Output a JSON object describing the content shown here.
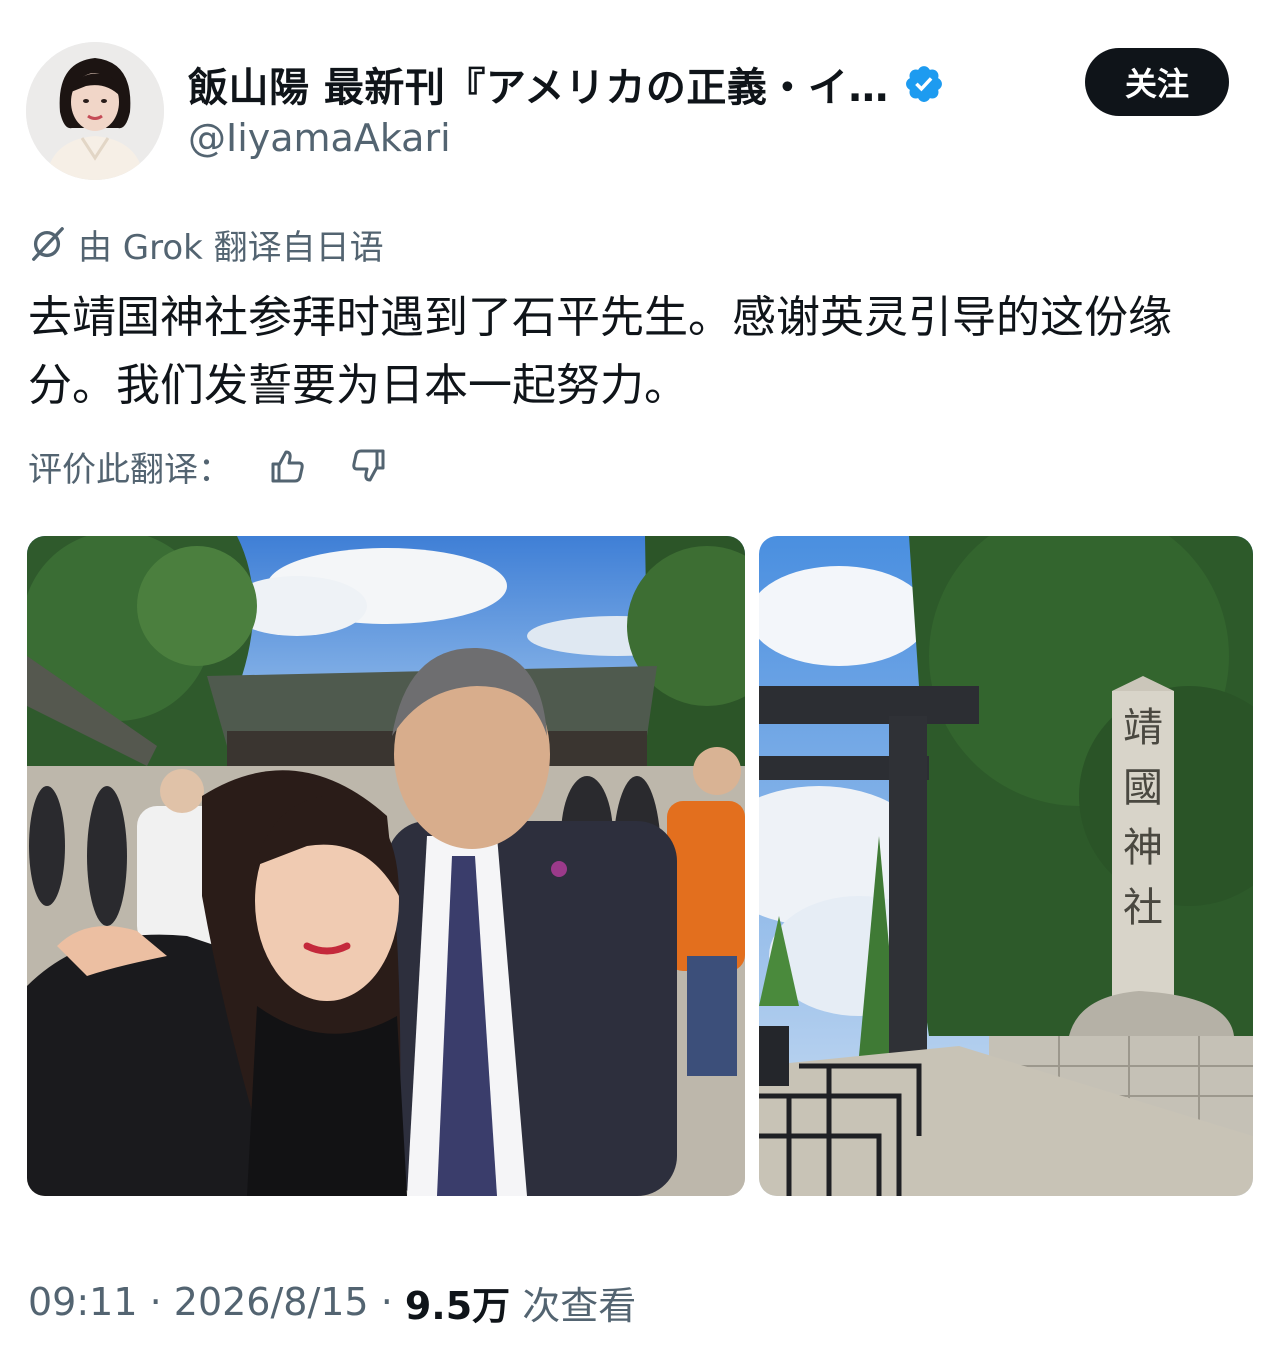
{
  "author": {
    "display_name": "飯山陽 最新刊『アメリカの正義・イ…",
    "handle": "@IiyamaAkari",
    "verified": true,
    "avatar_icon": "profile-photo"
  },
  "follow_button": {
    "label": "关注"
  },
  "translation": {
    "note": "由 Grok 翻译自日语",
    "icon": "grok-icon",
    "rate_label": "评价此翻译：",
    "thumbs_up_icon": "thumbs-up-icon",
    "thumbs_down_icon": "thumbs-down-icon"
  },
  "tweet": {
    "text": "去靖国神社参拜时遇到了石平先生。感谢英灵引导的这份缘分。我们发誓要为日本一起努力。"
  },
  "media": {
    "photo_1": "selfie at shrine",
    "photo_2": "torii gate and stone pillar",
    "pillar_text": "靖國神社"
  },
  "meta": {
    "time": "09:11",
    "sep1": " · ",
    "date": "2026/8/15",
    "sep2": " · ",
    "views": "9.5万",
    "views_suffix": " 次查看"
  },
  "colors": {
    "text": "#0f1419",
    "secondary": "#536471",
    "verified": "#1d9bf0",
    "follow_bg": "#0f1419"
  }
}
